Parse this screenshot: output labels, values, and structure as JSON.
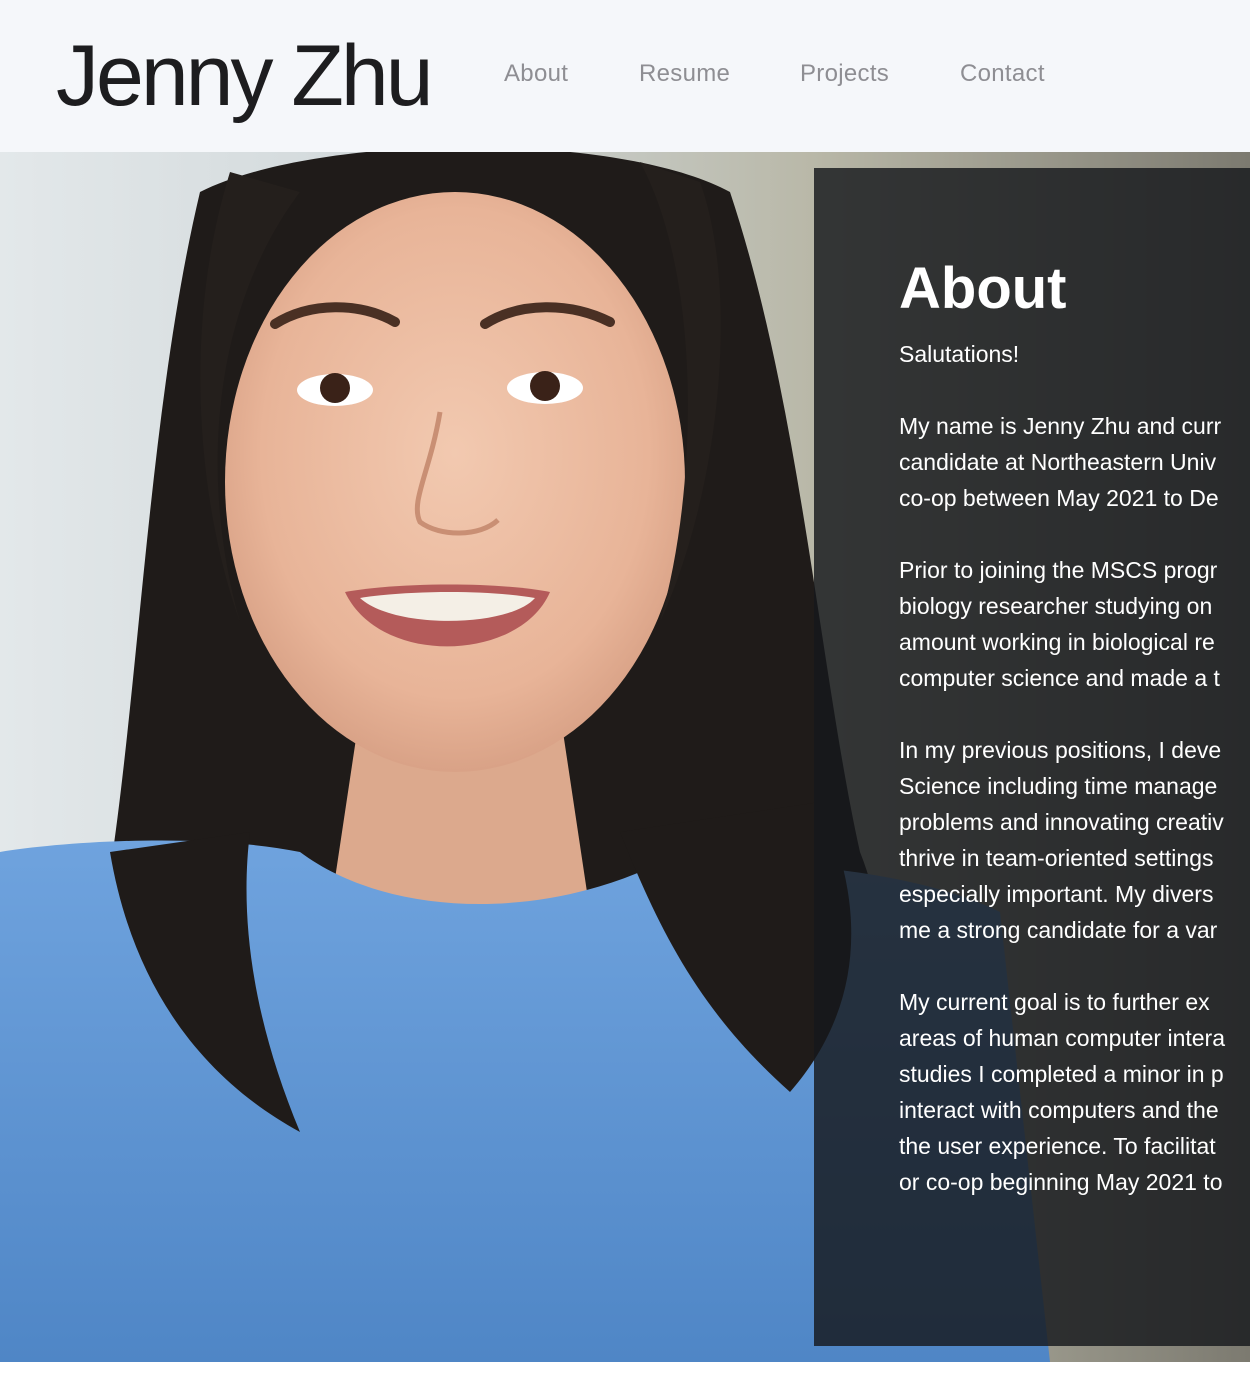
{
  "site": {
    "title": "Jenny Zhu"
  },
  "nav": {
    "items": [
      {
        "label": "About"
      },
      {
        "label": "Resume"
      },
      {
        "label": "Projects"
      },
      {
        "label": "Contact"
      }
    ]
  },
  "about": {
    "heading": "About",
    "greeting": "Salutations!",
    "paragraphs": [
      {
        "lines": [
          "My name is Jenny Zhu and curr",
          "candidate at Northeastern Univ",
          "co-op between May 2021 to De"
        ]
      },
      {
        "lines": [
          "Prior to joining the MSCS progr",
          "biology researcher studying on",
          "amount working in biological re",
          "computer science and made a t"
        ]
      },
      {
        "lines": [
          "In my previous positions, I deve",
          "Science including time manage",
          "problems and innovating creativ",
          "thrive in team-oriented settings",
          "especially important. My divers",
          "me a strong candidate for a var"
        ]
      },
      {
        "lines": [
          "My current goal is to further ex",
          "areas of human computer intera",
          "studies I completed a minor in p",
          "interact with computers and the",
          "the user experience. To facilitat",
          "or co-op beginning May 2021 to"
        ]
      }
    ]
  }
}
